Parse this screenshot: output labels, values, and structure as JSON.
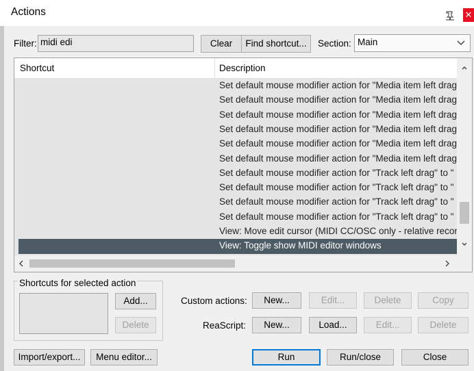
{
  "window": {
    "title": "Actions",
    "close_glyph": "✕"
  },
  "filter": {
    "label": "Filter:",
    "value": "midi edi"
  },
  "buttons": {
    "clear": "Clear",
    "find_shortcut": "Find shortcut..."
  },
  "section": {
    "label": "Section:",
    "value": "Main"
  },
  "list": {
    "columns": [
      "Shortcut",
      "Description"
    ],
    "rows": [
      {
        "shortcut": "",
        "description": "Set default mouse modifier action for \"Media item left drag\"",
        "selected": false
      },
      {
        "shortcut": "",
        "description": "Set default mouse modifier action for \"Media item left drag\"",
        "selected": false
      },
      {
        "shortcut": "",
        "description": "Set default mouse modifier action for \"Media item left drag\"",
        "selected": false
      },
      {
        "shortcut": "",
        "description": "Set default mouse modifier action for \"Media item left drag\"",
        "selected": false
      },
      {
        "shortcut": "",
        "description": "Set default mouse modifier action for \"Media item left drag\"",
        "selected": false
      },
      {
        "shortcut": "",
        "description": "Set default mouse modifier action for \"Media item left drag\"",
        "selected": false
      },
      {
        "shortcut": "",
        "description": "Set default mouse modifier action for \"Track left drag\" to \"",
        "selected": false
      },
      {
        "shortcut": "",
        "description": "Set default mouse modifier action for \"Track left drag\" to \"",
        "selected": false
      },
      {
        "shortcut": "",
        "description": "Set default mouse modifier action for \"Track left drag\" to \"",
        "selected": false
      },
      {
        "shortcut": "",
        "description": "Set default mouse modifier action for \"Track left drag\" to \"",
        "selected": false
      },
      {
        "shortcut": "",
        "description": "View: Move edit cursor (MIDI CC/OSC only - relative recon",
        "selected": false
      },
      {
        "shortcut": "",
        "description": "View: Toggle show MIDI editor windows",
        "selected": true
      }
    ]
  },
  "shortcuts_group": {
    "label": "Shortcuts for selected action",
    "add": "Add...",
    "delete": "Delete"
  },
  "custom_actions": {
    "label": "Custom actions:",
    "new": "New...",
    "edit": "Edit...",
    "delete": "Delete",
    "copy": "Copy"
  },
  "reascript": {
    "label": "ReaScript:",
    "new": "New...",
    "load": "Load...",
    "edit": "Edit...",
    "delete": "Delete"
  },
  "bottom": {
    "import_export": "Import/export...",
    "menu_editor": "Menu editor...",
    "run": "Run",
    "run_close": "Run/close",
    "close": "Close"
  }
}
